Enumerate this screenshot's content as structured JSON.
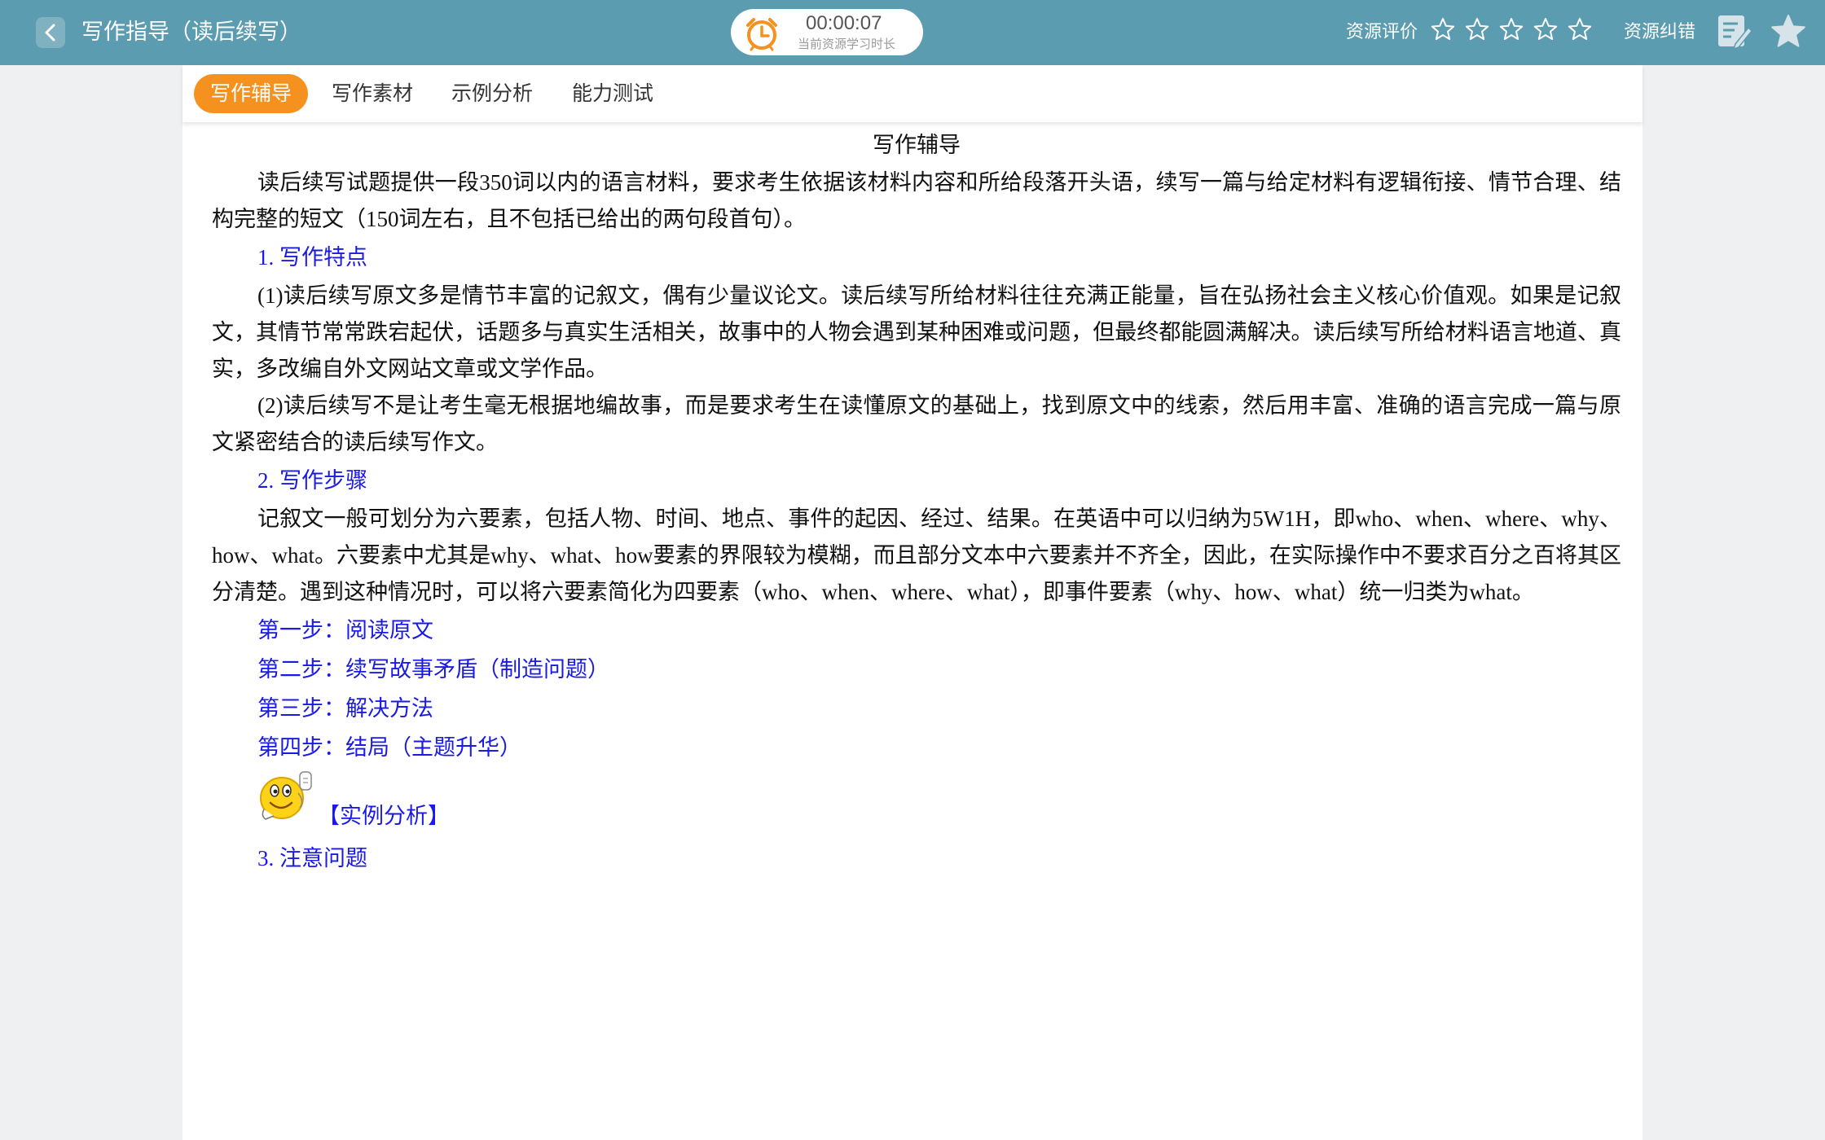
{
  "header": {
    "title": "写作指导（读后续写）",
    "timer_value": "00:00:07",
    "timer_caption": "当前资源学习时长",
    "rating_label": "资源评价",
    "rating": {
      "value": 0,
      "max": 5
    },
    "correct_label": "资源纠错"
  },
  "colors": {
    "topbar": "#5b9cb0",
    "active_tab": "#f5911e",
    "heading_blue": "#1a1ae6",
    "timer_orange": "#f5911e"
  },
  "tabs": [
    {
      "label": "写作辅导",
      "active": true
    },
    {
      "label": "写作素材",
      "active": false
    },
    {
      "label": "示例分析",
      "active": false
    },
    {
      "label": "能力测试",
      "active": false
    }
  ],
  "content": {
    "title": "写作辅导",
    "intro": "读后续写试题提供一段350词以内的语言材料，要求考生依据该材料内容和所给段落开头语，续写一篇与给定材料有逻辑衔接、情节合理、结构完整的短文（150词左右，且不包括已给出的两句段首句）。",
    "h1": "1. 写作特点",
    "p1": "(1)读后续写原文多是情节丰富的记叙文，偶有少量议论文。读后续写所给材料往往充满正能量，旨在弘扬社会主义核心价值观。如果是记叙文，其情节常常跌宕起伏，话题多与真实生活相关，故事中的人物会遇到某种困难或问题，但最终都能圆满解决。读后续写所给材料语言地道、真实，多改编自外文网站文章或文学作品。",
    "p2": "(2)读后续写不是让考生毫无根据地编故事，而是要求考生在读懂原文的基础上，找到原文中的线索，然后用丰富、准确的语言完成一篇与原文紧密结合的读后续写作文。",
    "h2": "2. 写作步骤",
    "p3": "记叙文一般可划分为六要素，包括人物、时间、地点、事件的起因、经过、结果。在英语中可以归纳为5W1H，即who、when、where、why、how、what。六要素中尤其是why、what、how要素的界限较为模糊，而且部分文本中六要素并不齐全，因此，在实际操作中不要求百分之百将其区分清楚。遇到这种情况时，可以将六要素简化为四要素（who、when、where、what），即事件要素（why、how、what）统一归类为what。",
    "steps": [
      "第一步：阅读原文",
      "第二步：续写故事矛盾（制造问题）",
      "第三步：解决方法",
      "第四步：结局（主题升华）"
    ],
    "example_link": "【实例分析】",
    "h3": "3. 注意问题"
  },
  "icons": {
    "back": "chevron-left-icon",
    "timer": "alarm-clock-icon",
    "star": "star-outline-icon",
    "edit": "edit-note-icon",
    "favorite": "star-filled-icon",
    "example": "smiley-thumbs-up-icon"
  }
}
